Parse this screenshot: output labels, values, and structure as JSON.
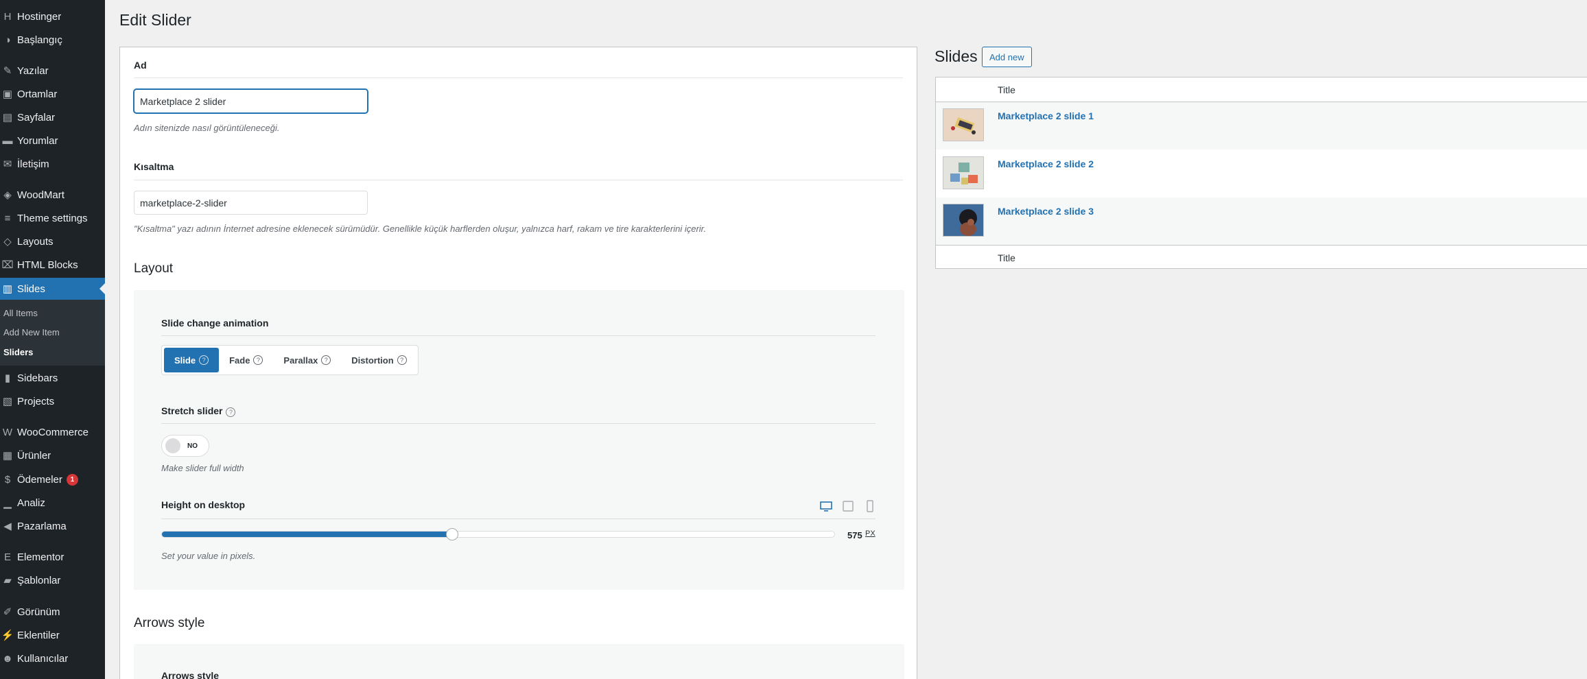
{
  "sidebar": {
    "items": [
      {
        "label": "Hostinger",
        "icon": "hostinger-icon",
        "glyph": "H"
      },
      {
        "label": "Başlangıç",
        "icon": "dashboard-icon",
        "glyph": "◑"
      },
      {
        "label": "Yazılar",
        "icon": "pin-icon",
        "glyph": "✎"
      },
      {
        "label": "Ortamlar",
        "icon": "media-icon",
        "glyph": "▣"
      },
      {
        "label": "Sayfalar",
        "icon": "pages-icon",
        "glyph": "▤"
      },
      {
        "label": "Yorumlar",
        "icon": "comments-icon",
        "glyph": "▬"
      },
      {
        "label": "İletişim",
        "icon": "mail-icon",
        "glyph": "✉"
      },
      {
        "label": "WoodMart",
        "icon": "woodmart-icon",
        "glyph": "◈"
      },
      {
        "label": "Theme settings",
        "icon": "sliders-icon",
        "glyph": "≡"
      },
      {
        "label": "Layouts",
        "icon": "layers-icon",
        "glyph": "◇"
      },
      {
        "label": "HTML Blocks",
        "icon": "code-icon",
        "glyph": "⌧"
      },
      {
        "label": "Slides",
        "icon": "slides-icon",
        "glyph": "▥"
      },
      {
        "label": "Sidebars",
        "icon": "sidebar-icon",
        "glyph": "▮"
      },
      {
        "label": "Projects",
        "icon": "projects-icon",
        "glyph": "▧"
      },
      {
        "label": "WooCommerce",
        "icon": "woocommerce-icon",
        "glyph": "W"
      },
      {
        "label": "Ürünler",
        "icon": "products-icon",
        "glyph": "▦"
      },
      {
        "label": "Ödemeler",
        "icon": "payments-icon",
        "glyph": "$",
        "badge": "1"
      },
      {
        "label": "Analiz",
        "icon": "analytics-icon",
        "glyph": "▁"
      },
      {
        "label": "Pazarlama",
        "icon": "megaphone-icon",
        "glyph": "◀"
      },
      {
        "label": "Elementor",
        "icon": "elementor-icon",
        "glyph": "E"
      },
      {
        "label": "Şablonlar",
        "icon": "folder-icon",
        "glyph": "▰"
      },
      {
        "label": "Görünüm",
        "icon": "brush-icon",
        "glyph": "✐"
      },
      {
        "label": "Eklentiler",
        "icon": "plugin-icon",
        "glyph": "⚡"
      },
      {
        "label": "Kullanıcılar",
        "icon": "user-icon",
        "glyph": "☻"
      }
    ],
    "submenu": [
      "All Items",
      "Add New Item",
      "Sliders"
    ]
  },
  "header": {
    "title": "Edit Slider"
  },
  "form": {
    "name_label": "Ad",
    "name_value": "Marketplace 2 slider",
    "name_hint": "Adın sitenizde nasıl görüntüleneceği.",
    "slug_label": "Kısaltma",
    "slug_value": "marketplace-2-slider",
    "slug_hint": "\"Kısaltma\" yazı adının İnternet adresine eklenecek sürümüdür. Genellikle küçük harflerden oluşur, yalnızca harf, rakam ve tire karakterlerini içerir.",
    "layout_title": "Layout",
    "anim_label": "Slide change animation",
    "anim_options": [
      "Slide",
      "Fade",
      "Parallax",
      "Distortion"
    ],
    "anim_selected": "Slide",
    "stretch_label": "Stretch slider",
    "stretch_value": "NO",
    "stretch_hint": "Make slider full width",
    "height_label": "Height on desktop",
    "height_value": "575",
    "height_unit": "PX",
    "height_fraction": 0.432,
    "height_hint": "Set your value in pixels.",
    "arrows_title": "Arrows style",
    "arrows_label": "Arrows style"
  },
  "slides": {
    "title": "Slides",
    "add_new": "Add new",
    "column": "Title",
    "footer_column": "Title",
    "rows": [
      "Marketplace 2 slide 1",
      "Marketplace 2 slide 2",
      "Marketplace 2 slide 3"
    ]
  },
  "colors": {
    "accent": "#2271b1",
    "sidebar_bg": "#1d2327",
    "badge": "#d63638"
  }
}
